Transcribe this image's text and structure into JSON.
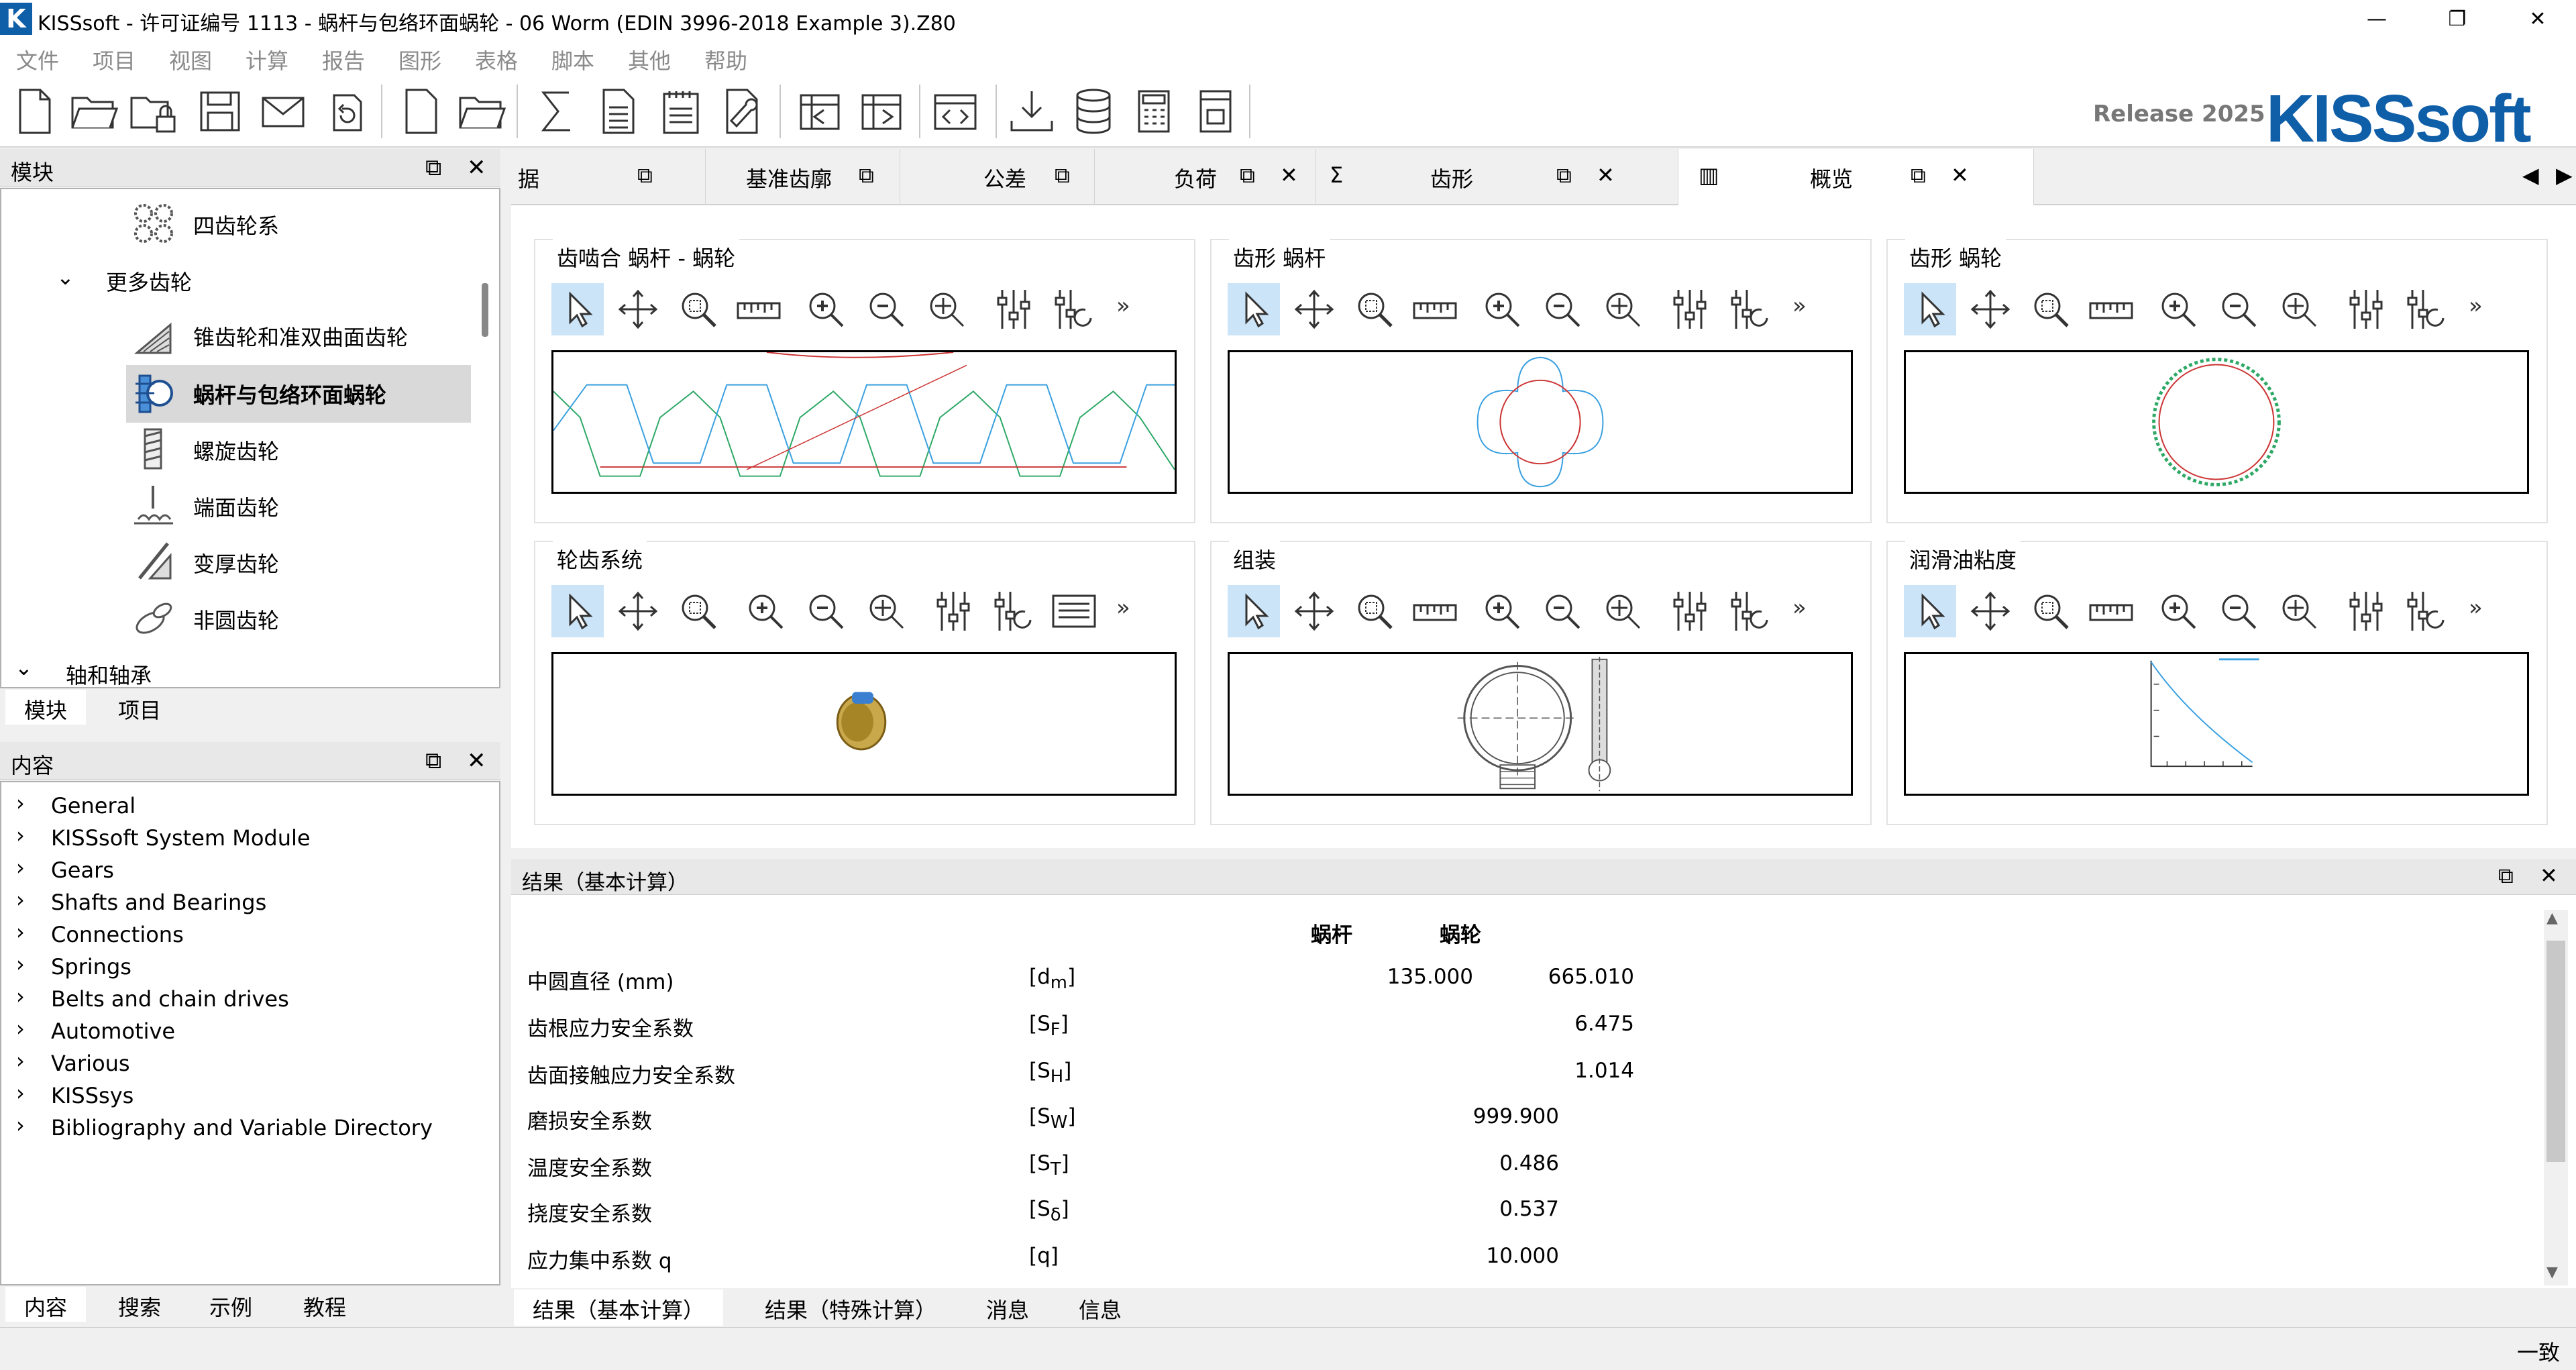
{
  "window": {
    "title": "KISSsoft - 许可证编号 1113 - 蜗杆与包络环面蜗轮 - 06 Worm (EDIN 3996-2018 Example 3).Z80",
    "logo_letter": "K",
    "minimize": "—",
    "maximize": "❐",
    "close": "✕"
  },
  "menu": [
    "文件",
    "项目",
    "视图",
    "计算",
    "报告",
    "图形",
    "表格",
    "脚本",
    "其他",
    "帮助"
  ],
  "branding": {
    "release": "Release 2025",
    "brand": "KISSsoft"
  },
  "modules_panel": {
    "title": "模块",
    "items": [
      {
        "label": "四齿轮系",
        "icon": "four-gears-icon"
      },
      {
        "label": "更多齿轮",
        "icon": "chevron-down-icon",
        "expander": "⌄"
      },
      {
        "label": "锥齿轮和准双曲面齿轮",
        "icon": "bevel-gear-icon"
      },
      {
        "label": "蜗杆与包络环面蜗轮",
        "icon": "worm-gear-icon"
      },
      {
        "label": "螺旋齿轮",
        "icon": "helical-gear-icon"
      },
      {
        "label": "端面齿轮",
        "icon": "face-gear-icon"
      },
      {
        "label": "变厚齿轮",
        "icon": "beveloid-gear-icon"
      },
      {
        "label": "非圆齿轮",
        "icon": "noncircular-gear-icon"
      },
      {
        "label": "轴和轴承",
        "icon": "chevron-down-icon",
        "expander": "⌄"
      }
    ],
    "tabs": [
      "模块",
      "项目"
    ]
  },
  "content_panel": {
    "title": "内容",
    "items": [
      "General",
      "KISSsoft System Module",
      "Gears",
      "Shafts and Bearings",
      "Connections",
      "Springs",
      "Belts and chain drives",
      "Automotive",
      "Various",
      "KISSsys",
      "Bibliography and Variable Directory"
    ],
    "tabs": [
      "内容",
      "搜索",
      "示例",
      "教程"
    ]
  },
  "doc_tabs": [
    {
      "label": "据"
    },
    {
      "label": "基准齿廓"
    },
    {
      "label": "公差"
    },
    {
      "label": "负荷"
    },
    {
      "label": "齿形"
    },
    {
      "label": "概览"
    }
  ],
  "panes": [
    {
      "title": "齿啮合 蜗杆 - 蜗轮"
    },
    {
      "title": "齿形 蜗杆"
    },
    {
      "title": "齿形 蜗轮"
    },
    {
      "title": "轮齿系统"
    },
    {
      "title": "组装"
    },
    {
      "title": "润滑油粘度"
    }
  ],
  "more_symbol": "»",
  "results": {
    "title": "结果（基本计算）",
    "col_headers": [
      "蜗杆",
      "蜗轮"
    ],
    "rows": [
      {
        "label": "中圆直径 (mm)",
        "sym": "d",
        "sub": "m",
        "v1": "135.000",
        "v2": "665.010"
      },
      {
        "label": "齿根应力安全系数",
        "sym": "S",
        "sub": "F",
        "v1": "",
        "v2": "6.475"
      },
      {
        "label": "齿面接触应力安全系数",
        "sym": "S",
        "sub": "H",
        "v1": "",
        "v2": "1.014"
      },
      {
        "label": "磨损安全系数",
        "sym": "S",
        "sub": "W",
        "v1": "",
        "vc": "999.900"
      },
      {
        "label": "温度安全系数",
        "sym": "S",
        "sub": "T",
        "v1": "",
        "vc": "0.486"
      },
      {
        "label": "挠度安全系数",
        "sym": "S",
        "sub": "δ",
        "v1": "",
        "vc": "0.537"
      },
      {
        "label": "应力集中系数 q",
        "sym": "q",
        "sub": "",
        "v1": "",
        "vc": "10.000"
      }
    ],
    "tabs": [
      "结果（基本计算）",
      "结果（特殊计算）",
      "消息",
      "信息"
    ]
  },
  "status": {
    "text": "一致"
  }
}
